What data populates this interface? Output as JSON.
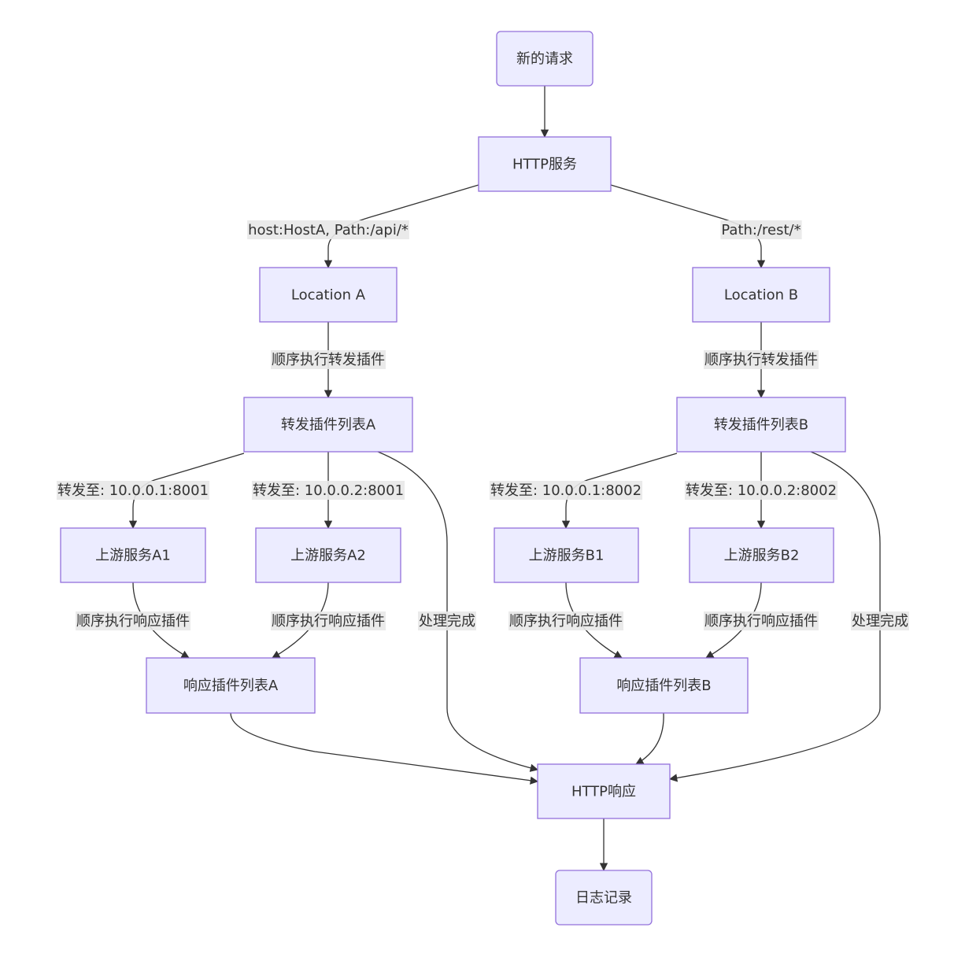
{
  "diagram": {
    "type": "flowchart",
    "direction": "top-down",
    "colors": {
      "node_fill": "#ECECFF",
      "node_stroke": "#9370DB",
      "edge": "#333333",
      "label_bg": "#E8E8E8",
      "text": "#333333"
    },
    "nodes": [
      {
        "id": "start",
        "label": "新的请求",
        "shape": "rounded"
      },
      {
        "id": "http",
        "label": "HTTP服务",
        "shape": "rect"
      },
      {
        "id": "locA",
        "label": "Location A",
        "shape": "rect"
      },
      {
        "id": "locB",
        "label": "Location B",
        "shape": "rect"
      },
      {
        "id": "fwdA",
        "label": "转发插件列表A",
        "shape": "rect"
      },
      {
        "id": "fwdB",
        "label": "转发插件列表B",
        "shape": "rect"
      },
      {
        "id": "A1",
        "label": "上游服务A1",
        "shape": "rect"
      },
      {
        "id": "A2",
        "label": "上游服务A2",
        "shape": "rect"
      },
      {
        "id": "B1",
        "label": "上游服务B1",
        "shape": "rect"
      },
      {
        "id": "B2",
        "label": "上游服务B2",
        "shape": "rect"
      },
      {
        "id": "respA",
        "label": "响应插件列表A",
        "shape": "rect"
      },
      {
        "id": "respB",
        "label": "响应插件列表B",
        "shape": "rect"
      },
      {
        "id": "httpresp",
        "label": "HTTP响应",
        "shape": "rect"
      },
      {
        "id": "log",
        "label": "日志记录",
        "shape": "rounded"
      }
    ],
    "edges": [
      {
        "from": "start",
        "to": "http",
        "label": ""
      },
      {
        "from": "http",
        "to": "locA",
        "label": "host:HostA, Path:/api/*"
      },
      {
        "from": "http",
        "to": "locB",
        "label": "Path:/rest/*"
      },
      {
        "from": "locA",
        "to": "fwdA",
        "label": "顺序执行转发插件"
      },
      {
        "from": "locB",
        "to": "fwdB",
        "label": "顺序执行转发插件"
      },
      {
        "from": "fwdA",
        "to": "A1",
        "label": "转发至: 10.0.0.1:8001"
      },
      {
        "from": "fwdA",
        "to": "A2",
        "label": "转发至: 10.0.0.2:8001"
      },
      {
        "from": "fwdA",
        "to": "httpresp",
        "label": "处理完成"
      },
      {
        "from": "fwdB",
        "to": "B1",
        "label": "转发至: 10.0.0.1:8002"
      },
      {
        "from": "fwdB",
        "to": "B2",
        "label": "转发至: 10.0.0.2:8002"
      },
      {
        "from": "fwdB",
        "to": "httpresp",
        "label": "处理完成"
      },
      {
        "from": "A1",
        "to": "respA",
        "label": "顺序执行响应插件"
      },
      {
        "from": "A2",
        "to": "respA",
        "label": "顺序执行响应插件"
      },
      {
        "from": "B1",
        "to": "respB",
        "label": "顺序执行响应插件"
      },
      {
        "from": "B2",
        "to": "respB",
        "label": "顺序执行响应插件"
      },
      {
        "from": "respA",
        "to": "httpresp",
        "label": ""
      },
      {
        "from": "respB",
        "to": "httpresp",
        "label": ""
      },
      {
        "from": "httpresp",
        "to": "log",
        "label": ""
      }
    ]
  }
}
